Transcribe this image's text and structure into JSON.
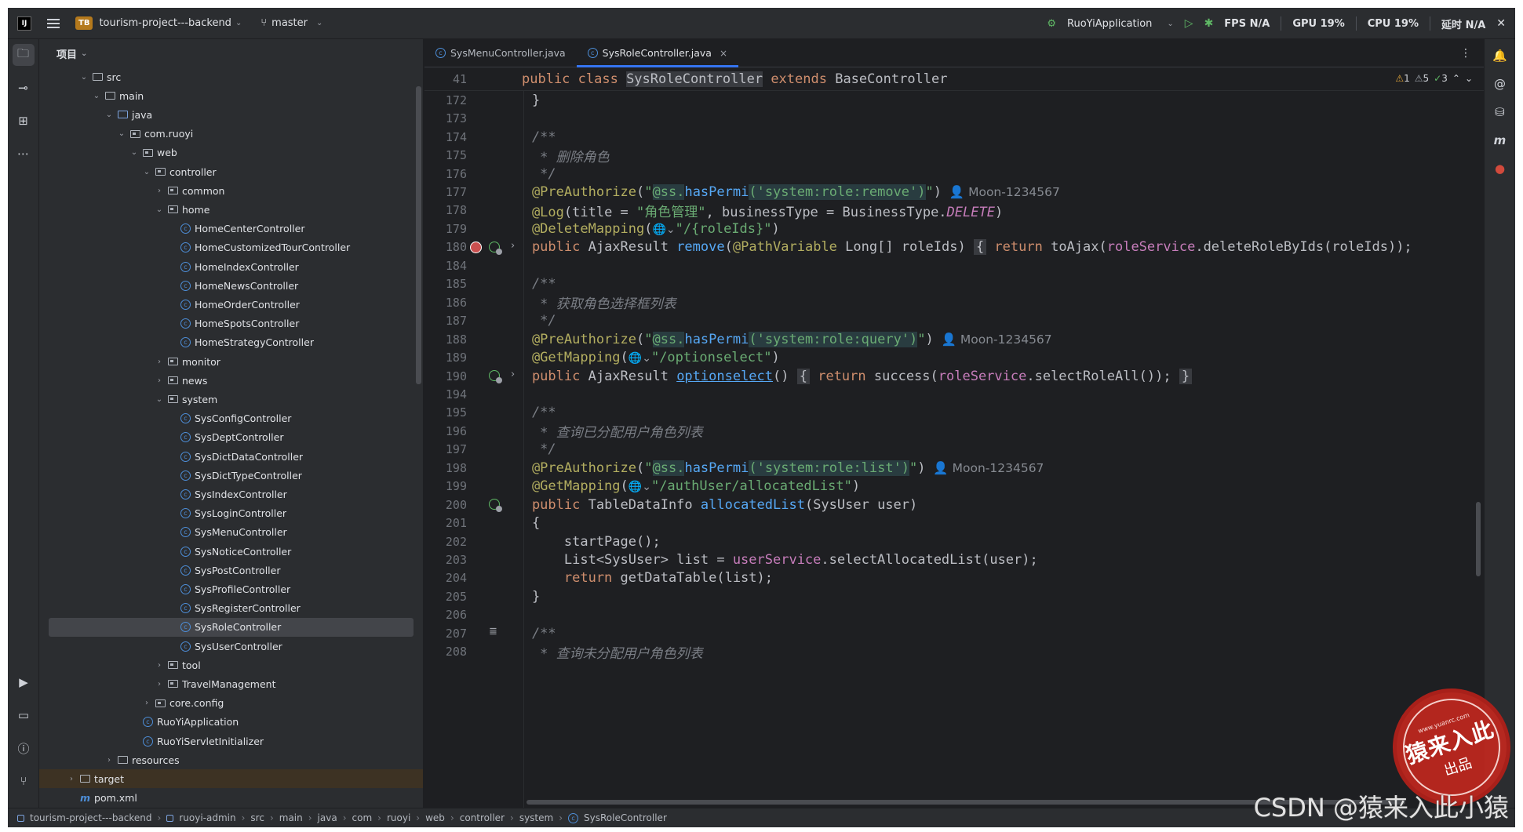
{
  "titlebar": {
    "project_badge": "TB",
    "project_name": "tourism-project---backend",
    "branch": "master",
    "run_config": "RuoYiApplication",
    "metrics": [
      {
        "label": "FPS",
        "value": "N/A"
      },
      {
        "label": "GPU",
        "value": "19%"
      },
      {
        "label": "CPU",
        "value": "19%"
      },
      {
        "label": "延时",
        "value": "N/A"
      }
    ]
  },
  "project_panel": {
    "title": "项目",
    "tree": [
      {
        "label": "src",
        "depth": 3,
        "kind": "folder",
        "expanded": true
      },
      {
        "label": "main",
        "depth": 4,
        "kind": "folder",
        "expanded": true
      },
      {
        "label": "java",
        "depth": 5,
        "kind": "src-folder",
        "expanded": true
      },
      {
        "label": "com.ruoyi",
        "depth": 6,
        "kind": "package",
        "expanded": true
      },
      {
        "label": "web",
        "depth": 7,
        "kind": "package",
        "expanded": true
      },
      {
        "label": "controller",
        "depth": 8,
        "kind": "package",
        "expanded": true
      },
      {
        "label": "common",
        "depth": 9,
        "kind": "package",
        "expanded": false
      },
      {
        "label": "home",
        "depth": 9,
        "kind": "package",
        "expanded": true
      },
      {
        "label": "HomeCenterController",
        "depth": 10,
        "kind": "class"
      },
      {
        "label": "HomeCustomizedTourController",
        "depth": 10,
        "kind": "class"
      },
      {
        "label": "HomeIndexController",
        "depth": 10,
        "kind": "class"
      },
      {
        "label": "HomeNewsController",
        "depth": 10,
        "kind": "class"
      },
      {
        "label": "HomeOrderController",
        "depth": 10,
        "kind": "class"
      },
      {
        "label": "HomeSpotsController",
        "depth": 10,
        "kind": "class"
      },
      {
        "label": "HomeStrategyController",
        "depth": 10,
        "kind": "class"
      },
      {
        "label": "monitor",
        "depth": 9,
        "kind": "package",
        "expanded": false
      },
      {
        "label": "news",
        "depth": 9,
        "kind": "package",
        "expanded": false
      },
      {
        "label": "system",
        "depth": 9,
        "kind": "package",
        "expanded": true
      },
      {
        "label": "SysConfigController",
        "depth": 10,
        "kind": "class"
      },
      {
        "label": "SysDeptController",
        "depth": 10,
        "kind": "class"
      },
      {
        "label": "SysDictDataController",
        "depth": 10,
        "kind": "class"
      },
      {
        "label": "SysDictTypeController",
        "depth": 10,
        "kind": "class"
      },
      {
        "label": "SysIndexController",
        "depth": 10,
        "kind": "class"
      },
      {
        "label": "SysLoginController",
        "depth": 10,
        "kind": "class"
      },
      {
        "label": "SysMenuController",
        "depth": 10,
        "kind": "class"
      },
      {
        "label": "SysNoticeController",
        "depth": 10,
        "kind": "class"
      },
      {
        "label": "SysPostController",
        "depth": 10,
        "kind": "class"
      },
      {
        "label": "SysProfileController",
        "depth": 10,
        "kind": "class"
      },
      {
        "label": "SysRegisterController",
        "depth": 10,
        "kind": "class"
      },
      {
        "label": "SysRoleController",
        "depth": 10,
        "kind": "class",
        "selected": true
      },
      {
        "label": "SysUserController",
        "depth": 10,
        "kind": "class"
      },
      {
        "label": "tool",
        "depth": 9,
        "kind": "package",
        "expanded": false
      },
      {
        "label": "TravelManagement",
        "depth": 9,
        "kind": "package",
        "expanded": false
      },
      {
        "label": "core.config",
        "depth": 8,
        "kind": "package",
        "expanded": false
      },
      {
        "label": "RuoYiApplication",
        "depth": 7,
        "kind": "class"
      },
      {
        "label": "RuoYiServletInitializer",
        "depth": 7,
        "kind": "class"
      },
      {
        "label": "resources",
        "depth": 5,
        "kind": "folder",
        "expanded": false
      },
      {
        "label": "target",
        "depth": 2,
        "kind": "folder",
        "expanded": false,
        "target": true
      },
      {
        "label": "pom.xml",
        "depth": 2,
        "kind": "maven"
      }
    ]
  },
  "editor": {
    "tabs": [
      {
        "label": "SysMenuController.java",
        "active": false
      },
      {
        "label": "SysRoleController.java",
        "active": true
      }
    ],
    "sticky": {
      "line": "41",
      "before": "public class ",
      "class_name": "SysRoleController",
      "after_kw": "extends",
      "after": " BaseController"
    },
    "inspections": {
      "warnings": "1",
      "weak_warnings": "5",
      "typos": "3"
    },
    "lines": [
      {
        "n": "172",
        "seg": [
          [
            "pl",
            "    }"
          ]
        ]
      },
      {
        "n": "173",
        "seg": []
      },
      {
        "n": "174",
        "seg": [
          [
            "cm",
            "    /**"
          ]
        ]
      },
      {
        "n": "175",
        "seg": [
          [
            "cm",
            "     * 删除角色"
          ]
        ]
      },
      {
        "n": "176",
        "seg": [
          [
            "cm",
            "     */"
          ]
        ]
      },
      {
        "n": "177",
        "seg": [
          [
            "an",
            "    @PreAuthorize"
          ],
          [
            "pl",
            "("
          ],
          [
            "s",
            "\""
          ],
          [
            "s-hl",
            "@ss."
          ],
          [
            "pm",
            "hasPermi"
          ],
          [
            "s-hl",
            "('system:role:remove')"
          ],
          [
            "s",
            "\""
          ],
          [
            "pl",
            ")"
          ],
          [
            "inlay",
            "  👤 Moon-1234567"
          ]
        ]
      },
      {
        "n": "178",
        "seg": [
          [
            "an",
            "    @Log"
          ],
          [
            "pl",
            "(title = "
          ],
          [
            "s",
            "\"角色管理\""
          ],
          [
            "pl",
            ", businessType = BusinessType."
          ],
          [
            "cst",
            "DELETE"
          ],
          [
            "pl",
            ")"
          ]
        ]
      },
      {
        "n": "179",
        "seg": [
          [
            "an",
            "    @DeleteMapping"
          ],
          [
            "pl",
            "("
          ],
          [
            "globe",
            "🌐⌄"
          ],
          [
            "s",
            "\"/{roleIds}\""
          ],
          [
            "pl",
            ")"
          ]
        ]
      },
      {
        "n": "180",
        "gutter": [
          "perm",
          "bean",
          "fold"
        ],
        "seg": [
          [
            "k",
            "    public "
          ],
          [
            "ty",
            "AjaxResult "
          ],
          [
            "fn",
            "remove"
          ],
          [
            "pl",
            "("
          ],
          [
            "an",
            "@PathVariable "
          ],
          [
            "ty",
            "Long"
          ],
          [
            "pl",
            "[] roleIds) "
          ],
          [
            "fold-b",
            "{"
          ],
          [
            "k",
            " return "
          ],
          [
            "pl",
            "toAjax("
          ],
          [
            "fld",
            "roleService"
          ],
          [
            "pl",
            ".deleteRoleByIds(roleIds));"
          ]
        ]
      },
      {
        "n": "184",
        "seg": []
      },
      {
        "n": "185",
        "seg": [
          [
            "cm",
            "    /**"
          ]
        ]
      },
      {
        "n": "186",
        "seg": [
          [
            "cm",
            "     * 获取角色选择框列表"
          ]
        ]
      },
      {
        "n": "187",
        "seg": [
          [
            "cm",
            "     */"
          ]
        ]
      },
      {
        "n": "188",
        "seg": [
          [
            "an",
            "    @PreAuthorize"
          ],
          [
            "pl",
            "("
          ],
          [
            "s",
            "\""
          ],
          [
            "s-hl",
            "@ss."
          ],
          [
            "pm",
            "hasPermi"
          ],
          [
            "s-hl",
            "('system:role:query')"
          ],
          [
            "s",
            "\""
          ],
          [
            "pl",
            ")"
          ],
          [
            "inlay",
            "  👤 Moon-1234567"
          ]
        ]
      },
      {
        "n": "189",
        "seg": [
          [
            "an",
            "    @GetMapping"
          ],
          [
            "pl",
            "("
          ],
          [
            "globe",
            "🌐⌄"
          ],
          [
            "s",
            "\"/optionselect\""
          ],
          [
            "pl",
            ")"
          ]
        ]
      },
      {
        "n": "190",
        "gutter": [
          "bean",
          "fold"
        ],
        "seg": [
          [
            "k",
            "    public "
          ],
          [
            "ty",
            "AjaxResult "
          ],
          [
            "fn-u",
            "optionselect"
          ],
          [
            "pl",
            "() "
          ],
          [
            "fold-b",
            "{"
          ],
          [
            "k",
            " return "
          ],
          [
            "pl",
            "success("
          ],
          [
            "fld",
            "roleService"
          ],
          [
            "pl",
            ".selectRoleAll()); "
          ],
          [
            "fold-b",
            "}"
          ]
        ]
      },
      {
        "n": "194",
        "seg": []
      },
      {
        "n": "195",
        "seg": [
          [
            "cm",
            "    /**"
          ]
        ]
      },
      {
        "n": "196",
        "seg": [
          [
            "cm",
            "     * 查询已分配用户角色列表"
          ]
        ]
      },
      {
        "n": "197",
        "seg": [
          [
            "cm",
            "     */"
          ]
        ]
      },
      {
        "n": "198",
        "seg": [
          [
            "an",
            "    @PreAuthorize"
          ],
          [
            "pl",
            "("
          ],
          [
            "s",
            "\""
          ],
          [
            "s-hl",
            "@ss."
          ],
          [
            "pm",
            "hasPermi"
          ],
          [
            "s-hl",
            "('system:role:list')"
          ],
          [
            "s",
            "\""
          ],
          [
            "pl",
            ")"
          ],
          [
            "inlay",
            "  👤 Moon-1234567"
          ]
        ]
      },
      {
        "n": "199",
        "seg": [
          [
            "an",
            "    @GetMapping"
          ],
          [
            "pl",
            "("
          ],
          [
            "globe",
            "🌐⌄"
          ],
          [
            "s",
            "\"/authUser/allocatedList\""
          ],
          [
            "pl",
            ")"
          ]
        ]
      },
      {
        "n": "200",
        "gutter": [
          "bean"
        ],
        "seg": [
          [
            "k",
            "    public "
          ],
          [
            "ty",
            "TableDataInfo "
          ],
          [
            "fn",
            "allocatedList"
          ],
          [
            "pl",
            "(SysUser user)"
          ]
        ]
      },
      {
        "n": "201",
        "seg": [
          [
            "pl",
            "    {"
          ]
        ]
      },
      {
        "n": "202",
        "seg": [
          [
            "pl",
            "        startPage();"
          ]
        ]
      },
      {
        "n": "203",
        "seg": [
          [
            "pl",
            "        List<SysUser> list = "
          ],
          [
            "fld",
            "userService"
          ],
          [
            "pl",
            ".selectAllocatedList(user);"
          ]
        ]
      },
      {
        "n": "204",
        "seg": [
          [
            "k",
            "        return "
          ],
          [
            "pl",
            "getDataTable(list);"
          ]
        ]
      },
      {
        "n": "205",
        "seg": [
          [
            "pl",
            "    }"
          ]
        ]
      },
      {
        "n": "206",
        "seg": []
      },
      {
        "n": "207",
        "gutter": [
          "doc"
        ],
        "seg": [
          [
            "cm",
            "    /**"
          ]
        ]
      },
      {
        "n": "208",
        "seg": [
          [
            "cm",
            "     * 查询未分配用户角色列表"
          ]
        ]
      }
    ]
  },
  "statusbar": {
    "breadcrumbs": [
      "tourism-project---backend",
      "ruoyi-admin",
      "src",
      "main",
      "java",
      "com",
      "ruoyi",
      "web",
      "controller",
      "system",
      "SysRoleController"
    ]
  },
  "watermark": {
    "stamp_url": "www.yuanrc.com",
    "stamp_title": "猿来入此",
    "stamp_sub": "出品",
    "csdn": "CSDN @猿来入此小猿"
  },
  "colors": {
    "accent": "#3574f0",
    "keyword": "#cf8e6d",
    "string": "#6aab73",
    "annotation": "#b3ae60",
    "method": "#56a8f5",
    "field": "#c77dbb",
    "comment": "#7a7e85"
  }
}
